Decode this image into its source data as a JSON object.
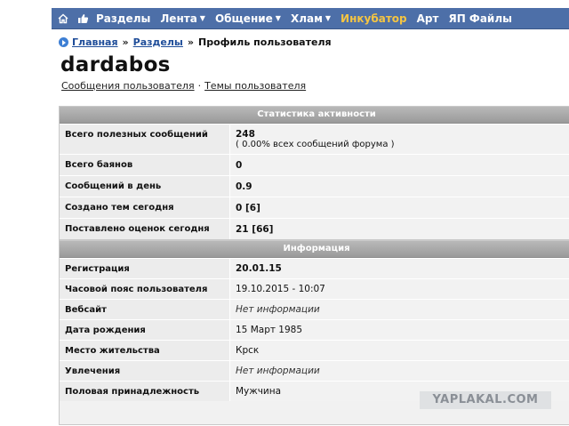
{
  "nav": {
    "items": [
      {
        "label": "Разделы",
        "dropdown": false,
        "accent": false
      },
      {
        "label": "Лента",
        "dropdown": true,
        "accent": false
      },
      {
        "label": "Общение",
        "dropdown": true,
        "accent": false
      },
      {
        "label": "Хлам",
        "dropdown": true,
        "accent": false
      },
      {
        "label": "Инкубатор",
        "dropdown": false,
        "accent": true
      },
      {
        "label": "Арт",
        "dropdown": false,
        "accent": false
      },
      {
        "label": "ЯП Файлы",
        "dropdown": false,
        "accent": false
      }
    ],
    "colors": {
      "bar": "#4d6fa8",
      "accent": "#f5c542"
    }
  },
  "breadcrumb": {
    "home": "Главная",
    "sep1": "»",
    "sections": "Разделы",
    "sep2": "»",
    "current": "Профиль пользователя"
  },
  "user": {
    "name": "dardabos",
    "posts_link": "Сообщения пользователя",
    "dot": "·",
    "topics_link": "Темы пользователя"
  },
  "stats": {
    "header": "Статистика активности",
    "rows": [
      {
        "label": "Всего полезных сообщений",
        "value": "248",
        "sub": "( 0.00% всех сообщений форума )"
      },
      {
        "label": "Всего баянов",
        "value": "0"
      },
      {
        "label": "Сообщений в день",
        "value": "0.9"
      },
      {
        "label": "Создано тем сегодня",
        "value": "0 [6]"
      },
      {
        "label": "Поставлено оценок сегодня",
        "value": "21 [66]"
      }
    ]
  },
  "info": {
    "header": "Информация",
    "rows": [
      {
        "label": "Регистрация",
        "value": "20.01.15",
        "style": "bold"
      },
      {
        "label": "Часовой пояс пользователя",
        "value": "19.10.2015 - 10:07",
        "style": "normal"
      },
      {
        "label": "Вебсайт",
        "value": "Нет информации",
        "style": "italic"
      },
      {
        "label": "Дата рождения",
        "value": "15 Март 1985",
        "style": "normal"
      },
      {
        "label": "Место жительства",
        "value": "Крск",
        "style": "normal"
      },
      {
        "label": "Увлечения",
        "value": "Нет информации",
        "style": "italic"
      },
      {
        "label": "Половая принадлежность",
        "value": "Мужчина",
        "style": "normal"
      }
    ]
  },
  "watermark": "YAPLAKAL.COM"
}
